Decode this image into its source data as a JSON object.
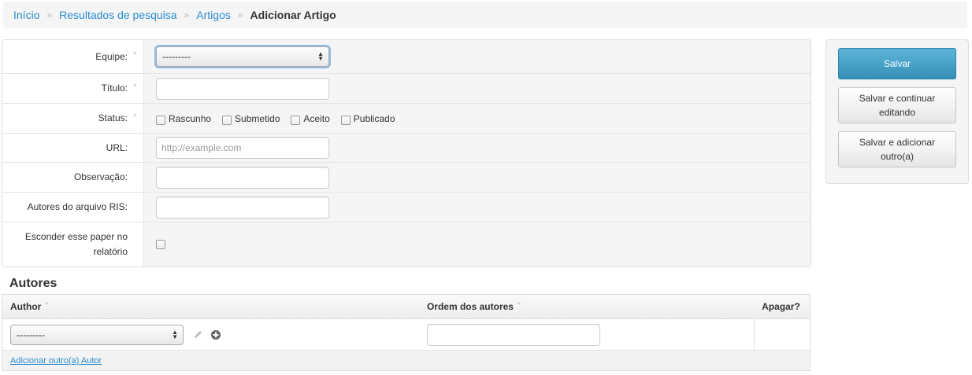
{
  "breadcrumb": {
    "items": [
      {
        "label": "Início"
      },
      {
        "label": "Resultados de pesquisa"
      },
      {
        "label": "Artigos"
      }
    ],
    "separator": "»",
    "current": "Adicionar Artigo"
  },
  "form": {
    "required_marker": "*",
    "team": {
      "label": "Equipe:",
      "value": "---------"
    },
    "title": {
      "label": "Título:",
      "value": ""
    },
    "status": {
      "label": "Status:",
      "options": [
        "Rascunho",
        "Submetido",
        "Aceito",
        "Publicado"
      ]
    },
    "url": {
      "label": "URL:",
      "placeholder": "http://example.com"
    },
    "observation": {
      "label": "Observação:",
      "value": ""
    },
    "ris_authors": {
      "label": "Autores do arquivo RIS:",
      "value": ""
    },
    "hide_paper": {
      "label": "Esconder esse paper no relatório"
    }
  },
  "actions": {
    "save": "Salvar",
    "save_continue": "Salvar e continuar editando",
    "save_add": "Salvar e adicionar outro(a)"
  },
  "authors": {
    "section_title": "Autores",
    "columns": {
      "author": "Author",
      "order": "Ordem dos autores",
      "delete": "Apagar?"
    },
    "row": {
      "author_value": "---------",
      "order_value": ""
    },
    "add_link": "Adicionar outro(a) Autor"
  },
  "colors": {
    "link": "#2a8ccf",
    "primary": "#3590b8"
  }
}
